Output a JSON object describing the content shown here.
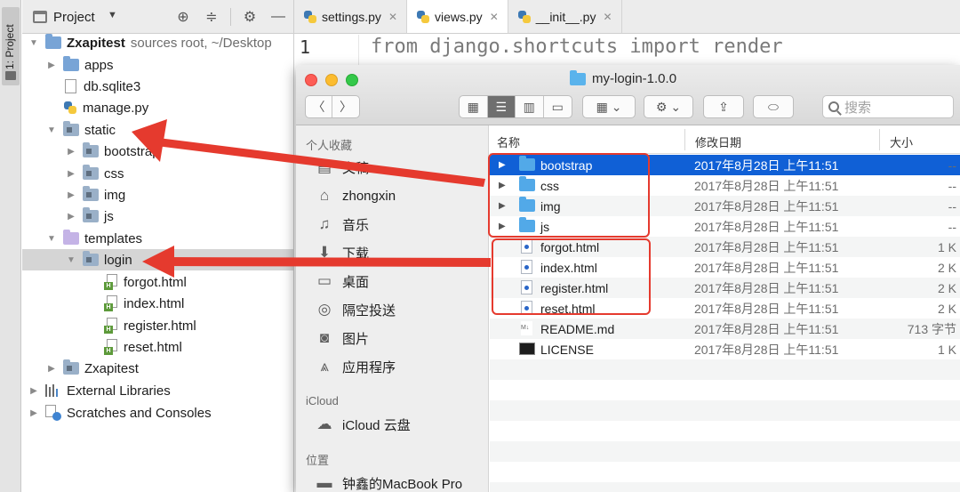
{
  "tool_strip": {
    "label": "1: Project"
  },
  "project_panel": {
    "title": "Project",
    "tree": [
      {
        "label": "Zxapitest",
        "suffix": "sources root,  ~/Desktop",
        "icon": "folder-icon",
        "bold": true
      },
      {
        "label": "apps",
        "icon": "folder-icon"
      },
      {
        "label": "db.sqlite3",
        "icon": "file-icon"
      },
      {
        "label": "manage.py",
        "icon": "python-file-icon"
      },
      {
        "label": "static",
        "icon": "folder-icon"
      },
      {
        "label": "bootstrap",
        "icon": "folder-icon"
      },
      {
        "label": "css",
        "icon": "folder-icon"
      },
      {
        "label": "img",
        "icon": "folder-icon"
      },
      {
        "label": "js",
        "icon": "folder-icon"
      },
      {
        "label": "templates",
        "icon": "templates-folder-icon"
      },
      {
        "label": "login",
        "icon": "folder-icon"
      },
      {
        "label": "forgot.html",
        "icon": "html-file-icon"
      },
      {
        "label": "index.html",
        "icon": "html-file-icon"
      },
      {
        "label": "register.html",
        "icon": "html-file-icon"
      },
      {
        "label": "reset.html",
        "icon": "html-file-icon"
      },
      {
        "label": "Zxapitest",
        "icon": "folder-icon"
      },
      {
        "label": "External Libraries",
        "icon": "libraries-icon"
      },
      {
        "label": "Scratches and Consoles",
        "icon": "scratches-icon"
      }
    ]
  },
  "editor": {
    "tabs": [
      {
        "label": "settings.py",
        "active": false
      },
      {
        "label": "views.py",
        "active": true
      },
      {
        "label": "__init__.py",
        "active": false
      }
    ],
    "line_number": "1",
    "code": "from django.shortcuts import render"
  },
  "finder": {
    "title": "my-login-1.0.0",
    "search_placeholder": "搜索",
    "sidebar": {
      "favorites_heading": "个人收藏",
      "favorites": [
        {
          "label": "文稿",
          "icon": "documents-icon"
        },
        {
          "label": "zhongxin",
          "icon": "home-icon"
        },
        {
          "label": "音乐",
          "icon": "music-icon"
        },
        {
          "label": "下载",
          "icon": "download-icon"
        },
        {
          "label": "桌面",
          "icon": "desktop-icon"
        },
        {
          "label": "隔空投送",
          "icon": "airdrop-icon"
        },
        {
          "label": "图片",
          "icon": "pictures-icon"
        },
        {
          "label": "应用程序",
          "icon": "applications-icon"
        }
      ],
      "icloud_heading": "iCloud",
      "icloud": [
        {
          "label": "iCloud 云盘",
          "icon": "cloud-icon"
        }
      ],
      "locations_heading": "位置",
      "locations": [
        {
          "label": "钟鑫的MacBook Pro",
          "icon": "laptop-icon"
        }
      ]
    },
    "columns": {
      "name": "名称",
      "modified": "修改日期",
      "size": "大小"
    },
    "files": [
      {
        "name": "bootstrap",
        "date": "2017年8月28日 上午11:51",
        "size": "--",
        "type": "folder",
        "selected": true
      },
      {
        "name": "css",
        "date": "2017年8月28日 上午11:51",
        "size": "--",
        "type": "folder"
      },
      {
        "name": "img",
        "date": "2017年8月28日 上午11:51",
        "size": "--",
        "type": "folder"
      },
      {
        "name": "js",
        "date": "2017年8月28日 上午11:51",
        "size": "--",
        "type": "folder"
      },
      {
        "name": "forgot.html",
        "date": "2017年8月28日 上午11:51",
        "size": "1 K",
        "type": "html"
      },
      {
        "name": "index.html",
        "date": "2017年8月28日 上午11:51",
        "size": "2 K",
        "type": "html"
      },
      {
        "name": "register.html",
        "date": "2017年8月28日 上午11:51",
        "size": "2 K",
        "type": "html"
      },
      {
        "name": "reset.html",
        "date": "2017年8月28日 上午11:51",
        "size": "2 K",
        "type": "html"
      },
      {
        "name": "README.md",
        "date": "2017年8月28日 上午11:51",
        "size": "713 字节",
        "type": "md"
      },
      {
        "name": "LICENSE",
        "date": "2017年8月28日 上午11:51",
        "size": "1 K",
        "type": "exec"
      }
    ]
  },
  "annotation": {
    "color": "#e53a2e"
  }
}
